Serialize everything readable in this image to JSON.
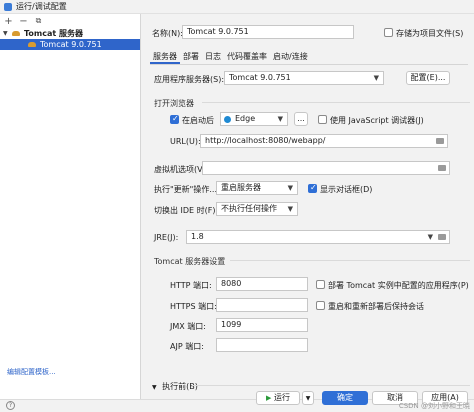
{
  "window": {
    "title": "运行/调试配置"
  },
  "left": {
    "toolbar": {
      "add": "+",
      "remove": "−"
    },
    "tree": {
      "parent": "Tomcat 服务器",
      "child": "Tomcat 9.0.751"
    },
    "edit_templates_link": "编辑配置模板..."
  },
  "header": {
    "name_label": "名称(N):",
    "name_value": "Tomcat 9.0.751",
    "store_label": "存储为项目文件(S)"
  },
  "tabs": [
    "服务器",
    "部署",
    "日志",
    "代码覆盖率",
    "启动/连接"
  ],
  "server": {
    "app_server_label": "应用程序服务器(S):",
    "app_server_value": "Tomcat 9.0.751",
    "configure_button": "配置(E)..."
  },
  "browser": {
    "section_title": "打开浏览器",
    "after_launch_label": "在启动后",
    "browser_value": "Edge",
    "more_button": "...",
    "js_debugger_label": "使用 JavaScript 调试器(J)",
    "url_label": "URL(U):",
    "url_value": "http://localhost:8080/webapp/"
  },
  "vm": {
    "label": "虚拟机选项(V):",
    "value": ""
  },
  "update": {
    "label": "执行\"更新\"操作...",
    "value": "重启服务器",
    "show_dialog_label": "显示对话框(D)"
  },
  "frame_deactivation": {
    "label": "切换出 IDE 时(F):",
    "value": "不执行任何操作"
  },
  "jre": {
    "label": "JRE(J):",
    "value": "1.8"
  },
  "tomcat_settings": {
    "section_title": "Tomcat 服务器设置",
    "http_label": "HTTP 端口:",
    "http_value": "8080",
    "https_label": "HTTPS 端口:",
    "https_value": "",
    "jmx_label": "JMX 端口:",
    "jmx_value": "1099",
    "ajp_label": "AJP 端口:",
    "ajp_value": "",
    "deploy_configured_label": "部署 Tomcat 实例中配置的应用程序(P)",
    "preserve_sessions_label": "重启和重新部署后保持会话"
  },
  "before_launch": {
    "label": "执行前(B)"
  },
  "footer": {
    "run_button": "运行",
    "ok_button": "确定",
    "cancel_button": "取消",
    "apply_button": "应用(A)",
    "watermark": "CSDN @刘小野和王晓"
  },
  "colors": {
    "accent": "#2f6fd6",
    "selection": "#2f65ca"
  }
}
